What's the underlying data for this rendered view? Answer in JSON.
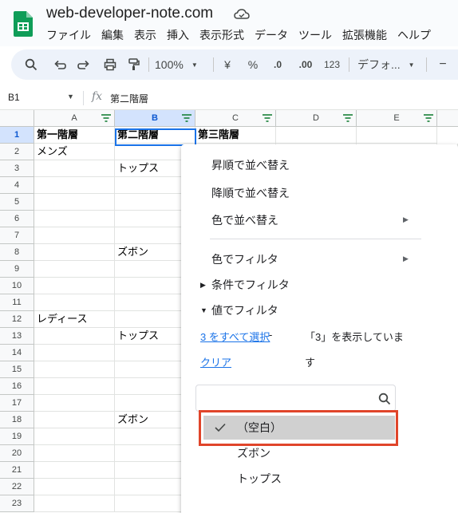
{
  "app": {
    "doc_title": "web-developer-note.com"
  },
  "menu": [
    "ファイル",
    "編集",
    "表示",
    "挿入",
    "表示形式",
    "データ",
    "ツール",
    "拡張機能",
    "ヘルプ"
  ],
  "toolbar": {
    "zoom": "100%",
    "currency": "¥",
    "percent": "%",
    "decrease_decimal": ".0",
    "increase_decimal": ".00",
    "number_format": "123",
    "font": "デフォ...",
    "font_size_minus": "−"
  },
  "formula_bar": {
    "name_box": "B1",
    "fx": "fx",
    "content": "第二階層"
  },
  "columns": [
    "A",
    "B",
    "C",
    "D",
    "E"
  ],
  "rows": [
    "1",
    "2",
    "3",
    "4",
    "5",
    "6",
    "7",
    "8",
    "9",
    "10",
    "11",
    "12",
    "13",
    "14",
    "15",
    "16",
    "17",
    "18",
    "19",
    "20",
    "21",
    "22",
    "23"
  ],
  "cells": {
    "a1": "第一階層",
    "b1": "第二階層",
    "c1": "第三階層",
    "a2": "メンズ",
    "b3": "トップス",
    "b8": "ズボン",
    "a12": "レディース",
    "b13": "トップス",
    "b18": "ズボン"
  },
  "filter_menu": {
    "sort_asc": "昇順で並べ替え",
    "sort_desc": "降順で並べ替え",
    "sort_by_color": "色で並べ替え",
    "filter_by_color": "色でフィルタ",
    "filter_by_condition": "条件でフィルタ",
    "filter_by_values": "値でフィルタ",
    "select_all": "3 をすべて選択",
    "dash": "-",
    "showing_text_1": "「3」を表示していま",
    "clear": "クリア",
    "showing_text_2": "す",
    "search_placeholder": "",
    "values": [
      {
        "label": "（空白）",
        "checked": true
      },
      {
        "label": "ズボン",
        "checked": false
      },
      {
        "label": "トップス",
        "checked": false
      }
    ]
  },
  "colors": {
    "accent": "#1a73e8",
    "highlight_border": "#e0452a",
    "sheets_green": "#0f9d58"
  }
}
